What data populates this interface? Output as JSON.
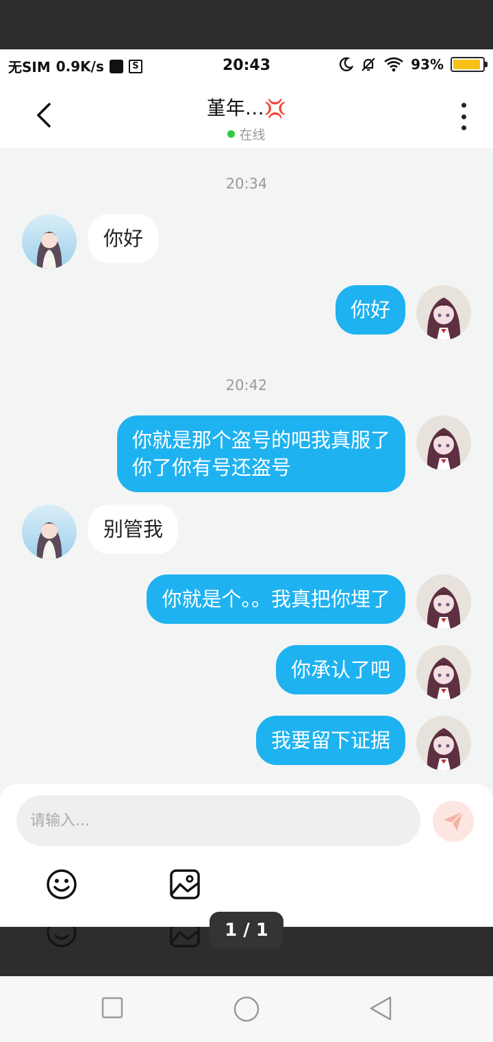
{
  "status_bar": {
    "carrier": "无SIM",
    "speed": "0.9K/s",
    "time": "20:43",
    "battery": "93%",
    "battery_level": 0.93,
    "battery_color": "#f7c11a"
  },
  "header": {
    "title": "堇年…",
    "title_emoji": "💢",
    "status": "在线"
  },
  "messages": {
    "ts1": "20:34",
    "m1": "你好",
    "m2": "你好",
    "ts2": "20:42",
    "m3": "你就是那个盗号的吧我真服了\n你了你有号还盗号",
    "m4": "别管我",
    "m5": "你就是个。。我真把你埋了",
    "m6": "你承认了吧",
    "m7": "我要留下证据"
  },
  "input": {
    "placeholder": "请输入..."
  },
  "pager": "1 / 1",
  "colors": {
    "bubble_out": "#1fb2f0",
    "bubble_in": "#ffffff",
    "online_dot": "#2ecc3e",
    "send_button": "#fde6e1"
  }
}
